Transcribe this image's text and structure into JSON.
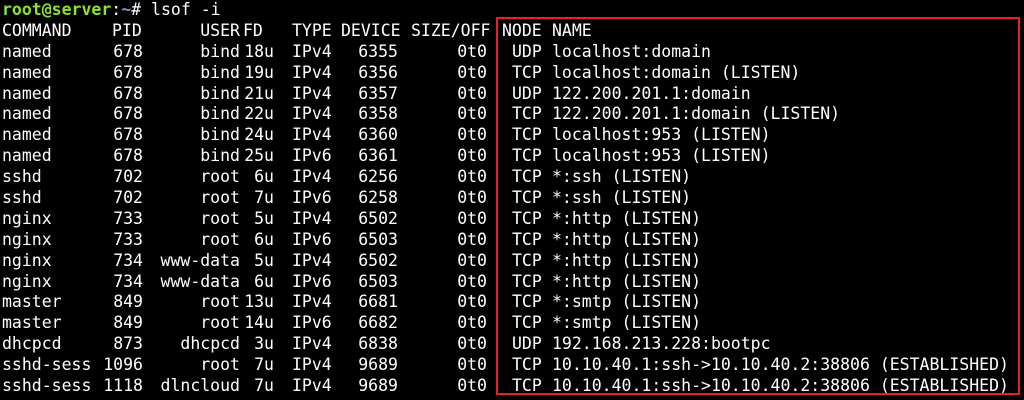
{
  "prompt": {
    "user_host": "root@server",
    "separator": ":",
    "path": "~",
    "symbol": "#",
    "command": "lsof -i"
  },
  "table": {
    "headers": {
      "command": "COMMAND",
      "pid": "PID",
      "user": "USER",
      "fd": "FD",
      "type": "TYPE",
      "device": "DEVICE",
      "size_off": "SIZE/OFF",
      "node": "NODE",
      "name": "NAME"
    },
    "rows": [
      {
        "command": "named",
        "pid": "678",
        "user": "bind",
        "fd": "18u",
        "type": "IPv4",
        "device": "6355",
        "size_off": "0t0",
        "node": "UDP",
        "name": "localhost:domain"
      },
      {
        "command": "named",
        "pid": "678",
        "user": "bind",
        "fd": "19u",
        "type": "IPv4",
        "device": "6356",
        "size_off": "0t0",
        "node": "TCP",
        "name": "localhost:domain (LISTEN)"
      },
      {
        "command": "named",
        "pid": "678",
        "user": "bind",
        "fd": "21u",
        "type": "IPv4",
        "device": "6357",
        "size_off": "0t0",
        "node": "UDP",
        "name": "122.200.201.1:domain"
      },
      {
        "command": "named",
        "pid": "678",
        "user": "bind",
        "fd": "22u",
        "type": "IPv4",
        "device": "6358",
        "size_off": "0t0",
        "node": "TCP",
        "name": "122.200.201.1:domain (LISTEN)"
      },
      {
        "command": "named",
        "pid": "678",
        "user": "bind",
        "fd": "24u",
        "type": "IPv4",
        "device": "6360",
        "size_off": "0t0",
        "node": "TCP",
        "name": "localhost:953 (LISTEN)"
      },
      {
        "command": "named",
        "pid": "678",
        "user": "bind",
        "fd": "25u",
        "type": "IPv6",
        "device": "6361",
        "size_off": "0t0",
        "node": "TCP",
        "name": "localhost:953 (LISTEN)"
      },
      {
        "command": "sshd",
        "pid": "702",
        "user": "root",
        "fd": "6u",
        "type": "IPv4",
        "device": "6256",
        "size_off": "0t0",
        "node": "TCP",
        "name": "*:ssh (LISTEN)"
      },
      {
        "command": "sshd",
        "pid": "702",
        "user": "root",
        "fd": "7u",
        "type": "IPv6",
        "device": "6258",
        "size_off": "0t0",
        "node": "TCP",
        "name": "*:ssh (LISTEN)"
      },
      {
        "command": "nginx",
        "pid": "733",
        "user": "root",
        "fd": "5u",
        "type": "IPv4",
        "device": "6502",
        "size_off": "0t0",
        "node": "TCP",
        "name": "*:http (LISTEN)"
      },
      {
        "command": "nginx",
        "pid": "733",
        "user": "root",
        "fd": "6u",
        "type": "IPv6",
        "device": "6503",
        "size_off": "0t0",
        "node": "TCP",
        "name": "*:http (LISTEN)"
      },
      {
        "command": "nginx",
        "pid": "734",
        "user": "www-data",
        "fd": "5u",
        "type": "IPv4",
        "device": "6502",
        "size_off": "0t0",
        "node": "TCP",
        "name": "*:http (LISTEN)"
      },
      {
        "command": "nginx",
        "pid": "734",
        "user": "www-data",
        "fd": "6u",
        "type": "IPv6",
        "device": "6503",
        "size_off": "0t0",
        "node": "TCP",
        "name": "*:http (LISTEN)"
      },
      {
        "command": "master",
        "pid": "849",
        "user": "root",
        "fd": "13u",
        "type": "IPv4",
        "device": "6681",
        "size_off": "0t0",
        "node": "TCP",
        "name": "*:smtp (LISTEN)"
      },
      {
        "command": "master",
        "pid": "849",
        "user": "root",
        "fd": "14u",
        "type": "IPv6",
        "device": "6682",
        "size_off": "0t0",
        "node": "TCP",
        "name": "*:smtp (LISTEN)"
      },
      {
        "command": "dhcpcd",
        "pid": "873",
        "user": "dhcpcd",
        "fd": "3u",
        "type": "IPv4",
        "device": "6838",
        "size_off": "0t0",
        "node": "UDP",
        "name": "192.168.213.228:bootpc"
      },
      {
        "command": "sshd-sess",
        "pid": "1096",
        "user": "root",
        "fd": "7u",
        "type": "IPv4",
        "device": "9689",
        "size_off": "0t0",
        "node": "TCP",
        "name": "10.10.40.1:ssh->10.10.40.2:38806 (ESTABLISHED)"
      },
      {
        "command": "sshd-sess",
        "pid": "1118",
        "user": "dlncloud",
        "fd": "7u",
        "type": "IPv4",
        "device": "9689",
        "size_off": "0t0",
        "node": "TCP",
        "name": "10.10.40.1:ssh->10.10.40.2:38806 (ESTABLISHED)"
      }
    ]
  },
  "colors": {
    "background": "#000000",
    "text": "#ffffff",
    "prompt_user": "#8ae234",
    "prompt_path": "#729fcf",
    "highlight": "#e8202a"
  }
}
